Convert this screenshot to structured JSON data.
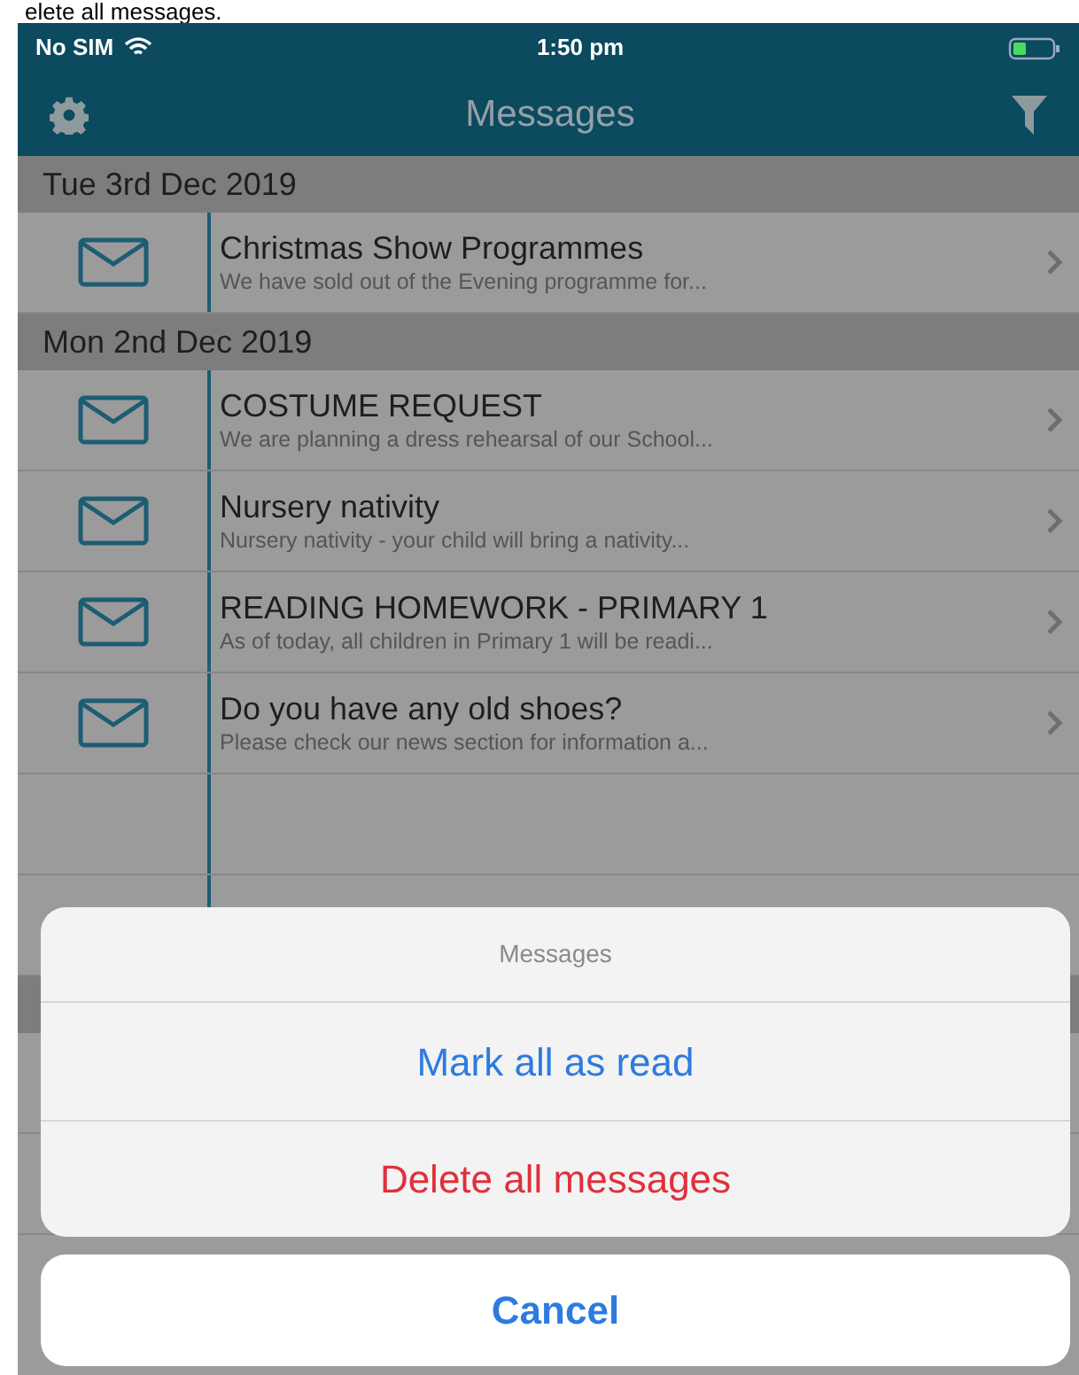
{
  "caption": "elete all messages.",
  "status_bar": {
    "carrier": "No SIM",
    "time": "1:50 pm"
  },
  "nav_bar": {
    "title": "Messages"
  },
  "sections": [
    {
      "date": "Tue 3rd Dec 2019",
      "messages": [
        {
          "title": "Christmas Show Programmes",
          "preview": "We have sold out of the Evening programme for..."
        }
      ]
    },
    {
      "date": "Mon 2nd Dec 2019",
      "messages": [
        {
          "title": "COSTUME REQUEST",
          "preview": "We are planning a dress rehearsal of our School..."
        },
        {
          "title": "Nursery nativity",
          "preview": "Nursery nativity - your child will bring a nativity..."
        },
        {
          "title": "READING HOMEWORK - PRIMARY 1",
          "preview": "As of today, all children in Primary 1 will be readi..."
        },
        {
          "title": "Do you have any old shoes?",
          "preview": "Please check our news section for information a..."
        }
      ]
    }
  ],
  "action_sheet": {
    "title": "Messages",
    "actions": [
      {
        "label": "Mark all as read",
        "kind": "default"
      },
      {
        "label": "Delete all messages",
        "kind": "destructive"
      }
    ],
    "cancel": "Cancel"
  }
}
